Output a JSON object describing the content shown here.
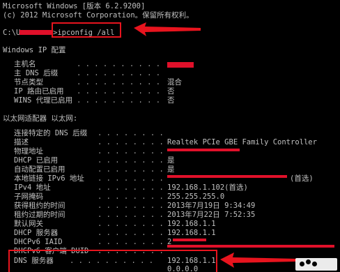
{
  "header": {
    "line1": "Microsoft Windows [版本 6.2.9200]",
    "line2": "(c) 2012 Microsoft Corporation。保留所有权利。"
  },
  "prompt": {
    "prefix": "C:\\U",
    "command": ">ipconfig /all"
  },
  "ip_config_heading": "Windows IP 配置",
  "host_section": [
    {
      "label": "主机名",
      "value": ""
    },
    {
      "label": "主 DNS 后缀",
      "value": ""
    },
    {
      "label": "节点类型",
      "value": "混合"
    },
    {
      "label": "IP 路由已启用",
      "value": "否"
    },
    {
      "label": "WINS 代理已启用",
      "value": "否"
    }
  ],
  "adapter_heading": "以太网适配器 以太网:",
  "adapter_section": [
    {
      "label": "连接特定的 DNS 后缀",
      "value": ""
    },
    {
      "label": "描述",
      "value": "Realtek PCIe GBE Family Controller"
    },
    {
      "label": "物理地址",
      "value": ""
    },
    {
      "label": "DHCP 已启用",
      "value": "是"
    },
    {
      "label": "自动配置已启用",
      "value": "是"
    },
    {
      "label": "本地链接 IPv6 地址",
      "value": "(首选)"
    },
    {
      "label": "IPv4 地址",
      "value": "192.168.1.102(首选)"
    },
    {
      "label": "子网掩码",
      "value": "255.255.255.0"
    },
    {
      "label": "获得租约的时间",
      "value": "2013年7月19日 9:34:49"
    },
    {
      "label": "租约过期的时间",
      "value": "2013年7月22日 7:52:35"
    },
    {
      "label": "默认网关",
      "value": "192.168.1.1"
    },
    {
      "label": "DHCP 服务器",
      "value": "192.168.1.1"
    },
    {
      "label": "DHCPv6 IAID",
      "value": "2"
    },
    {
      "label": "DHCPv6 客户端 DUID",
      "value": ""
    }
  ],
  "dns_section": {
    "label": "DNS 服务器",
    "value1": "192.168.1.1",
    "value2": "0.0.0.0"
  },
  "colors": {
    "background": "#000000",
    "text": "#c0c0c0",
    "annotation_red": "#e8141e"
  }
}
